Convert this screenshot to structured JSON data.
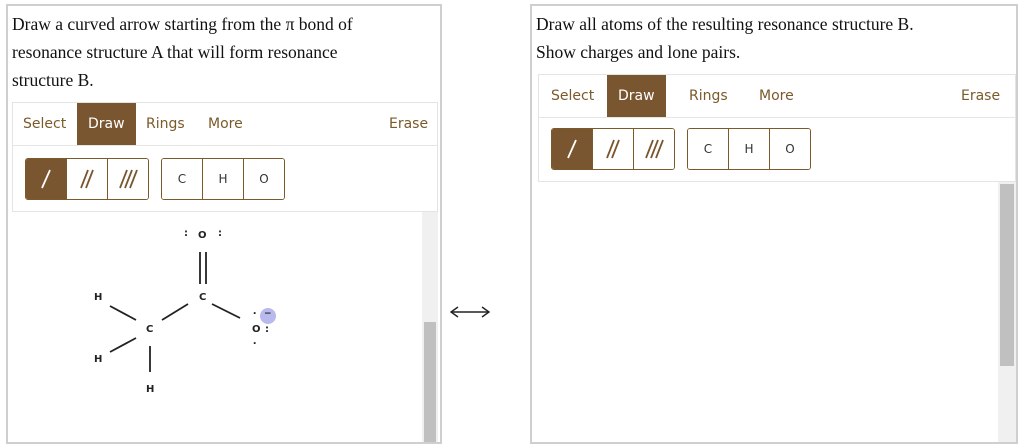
{
  "panel_a": {
    "prompt": "Draw a curved arrow starting from the π bond of\nresonance structure A that will form resonance\nstructure B.",
    "toolbar": {
      "select": "Select",
      "draw": "Draw",
      "rings": "Rings",
      "more": "More",
      "erase": "Erase"
    },
    "atoms": {
      "c": "C",
      "h": "H",
      "o": "O"
    },
    "molecule": {
      "o_top": "O",
      "c_carbonyl": "C",
      "c_center": "C",
      "o_right": "O",
      "h1": "H",
      "h2": "H",
      "h3": "H",
      "lone_pair_top_left": ":",
      "lone_pair_top_right": ":",
      "lone_pair_right": ":",
      "lone_pair_o_top": "․",
      "lone_pair_o_bottom": "․",
      "charge": "−"
    }
  },
  "panel_b": {
    "prompt": "Draw all atoms of the resulting resonance structure B.\nShow charges and lone pairs.",
    "toolbar": {
      "select": "Select",
      "draw": "Draw",
      "rings": "Rings",
      "more": "More",
      "erase": "Erase"
    },
    "atoms": {
      "c": "C",
      "h": "H",
      "o": "O"
    }
  },
  "arrow_symbol": "⟷",
  "colors": {
    "accent": "#7a5630",
    "charge": "#b9b9ee"
  }
}
